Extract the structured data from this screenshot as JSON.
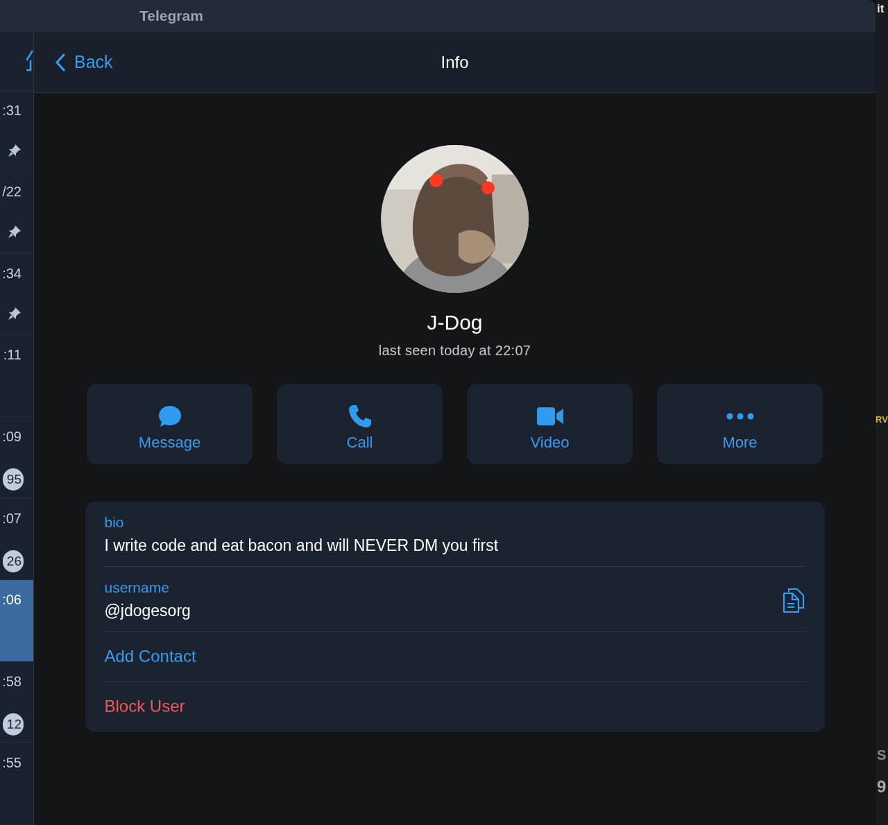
{
  "window": {
    "title": "Telegram"
  },
  "chat_list": [
    {
      "time": ":31",
      "pinned": true,
      "selected": false
    },
    {
      "time": "/22",
      "pinned": true,
      "selected": false
    },
    {
      "time": ":34",
      "pinned": true,
      "selected": false
    },
    {
      "time": ":11",
      "pinned": false,
      "selected": false
    },
    {
      "time": ":09",
      "pinned": false,
      "unread": "95",
      "selected": false
    },
    {
      "time": ":07",
      "pinned": false,
      "unread": "26",
      "selected": false
    },
    {
      "time": ":06",
      "pinned": false,
      "selected": true
    },
    {
      "time": ":58",
      "pinned": false,
      "unread": "12",
      "selected": false
    },
    {
      "time": ":55",
      "pinned": false,
      "selected": false
    }
  ],
  "header": {
    "back": "Back",
    "title": "Info"
  },
  "profile": {
    "name": "J-Dog",
    "status": "last seen today at 22:07"
  },
  "actions": [
    {
      "kind": "message",
      "label": "Message"
    },
    {
      "kind": "call",
      "label": "Call"
    },
    {
      "kind": "video",
      "label": "Video"
    },
    {
      "kind": "more",
      "label": "More"
    }
  ],
  "info": {
    "bio": {
      "label": "bio",
      "value": "I write code and eat bacon and will NEVER DM you first"
    },
    "username": {
      "label": "username",
      "value": "@jdogesorg"
    },
    "links": [
      {
        "kind": "normal",
        "label": "Add Contact"
      },
      {
        "kind": "danger",
        "label": "Block User"
      }
    ]
  },
  "background_window": {
    "texts": [
      "it",
      "RV",
      "S",
      "9"
    ]
  }
}
